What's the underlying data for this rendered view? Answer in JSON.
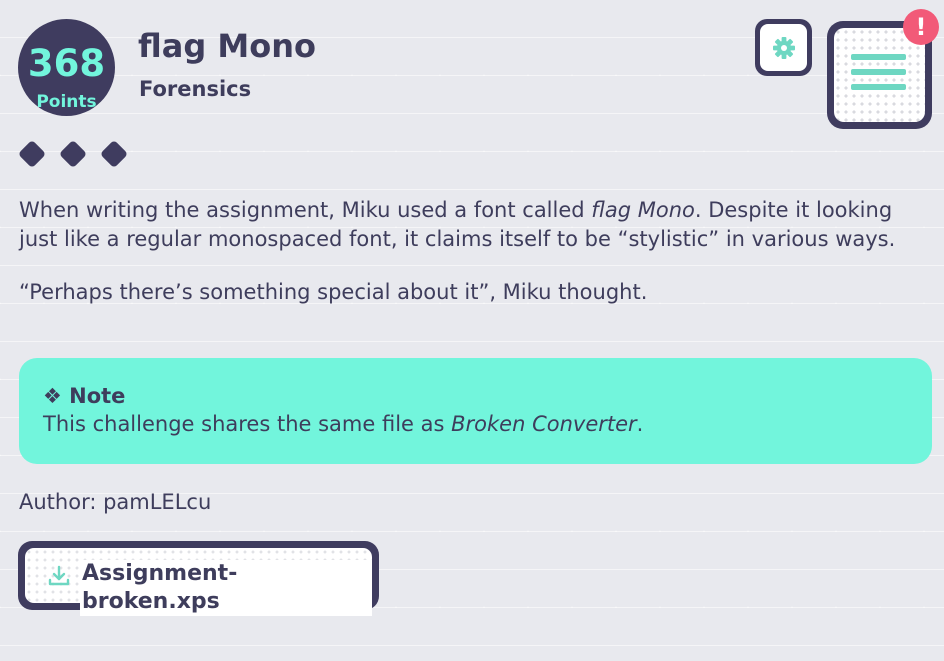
{
  "challenge": {
    "points_value": "368",
    "points_label": "Points",
    "title": "flag Mono",
    "category": "Forensics",
    "difficulty_level": 3
  },
  "description": {
    "p1_before": "When writing the assignment, Miku used a font called ",
    "p1_em": "flag Mono",
    "p1_after": ". Despite it looking just like a regular monospaced font, it claims itself to be “stylistic” in various ways.",
    "p2": "“Perhaps there’s something special about it”, Miku thought."
  },
  "note": {
    "icon": "❖",
    "title": "Note",
    "body_before": "This challenge shares the same file as ",
    "body_em": "Broken Converter",
    "body_after": "."
  },
  "author": "Author: pamLELcu",
  "download": {
    "icon": "download-icon",
    "label": "Assignment-broken.xps"
  },
  "toolbar": {
    "settings_icon": "gear-icon",
    "menu_icon": "hamburger-menu-icon",
    "alert_text": "!"
  },
  "colors": {
    "dark": "#3f3c5f",
    "accent": "#72f5dc",
    "alert": "#f25a78"
  }
}
